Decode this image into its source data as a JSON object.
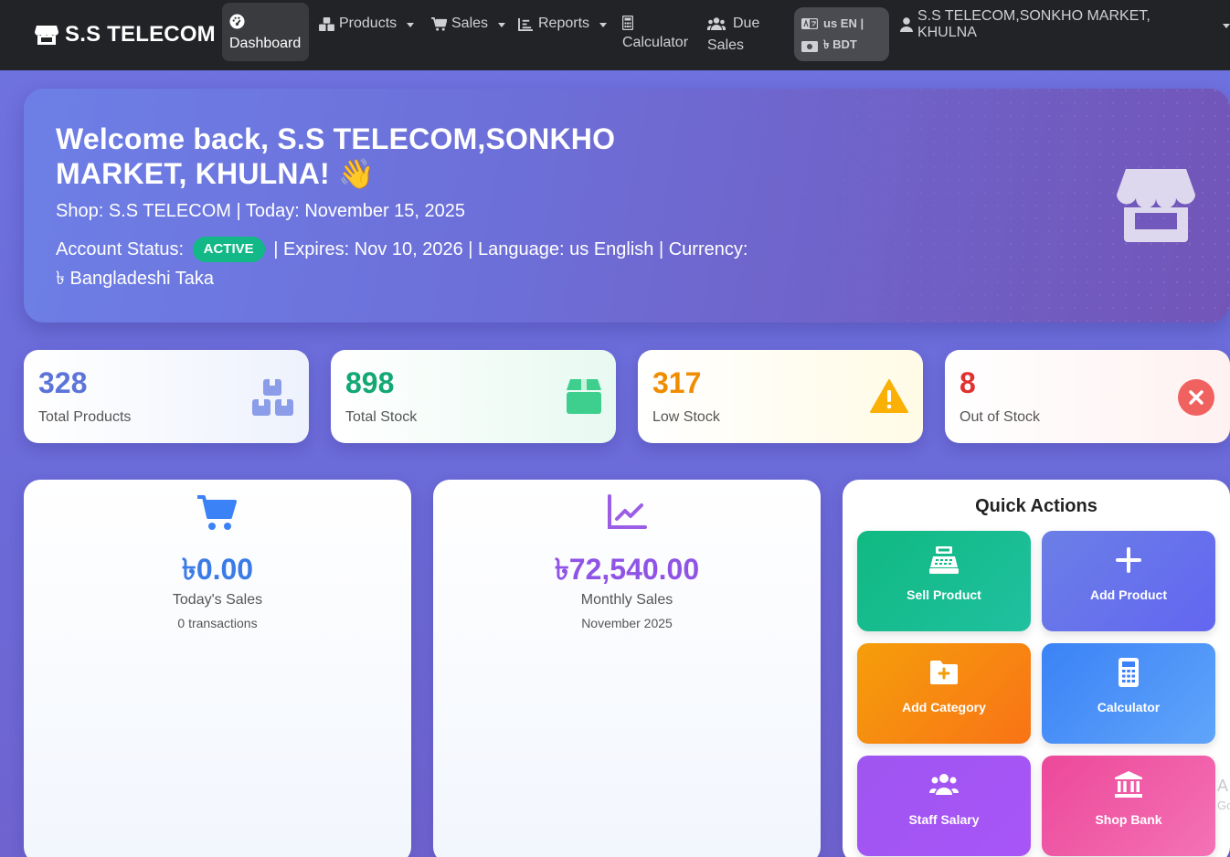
{
  "nav": {
    "brand": "S.S TELECOM",
    "dashboard": "Dashboard",
    "products": "Products",
    "sales": "Sales",
    "reports": "Reports",
    "calculator": "Calculator",
    "due_sales_line1": "Due",
    "due_sales_line2": "Sales",
    "lang_line1": "us EN |",
    "lang_line2": "৳ BDT",
    "user": "S.S TELECOM,SONKHO MARKET, KHULNA"
  },
  "hero": {
    "welcome": "Welcome back, S.S TELECOM,SONKHO MARKET, KHULNA! 👋",
    "shop_line": "Shop: S.S TELECOM | Today: November 15, 2025",
    "status_label": "Account Status:",
    "status_badge": "ACTIVE",
    "status_rest": "| Expires: Nov 10, 2026 | Language: us English | Currency: ৳ Bangladeshi Taka"
  },
  "stats": [
    {
      "value": "328",
      "label": "Total Products",
      "color": "#5b74d8"
    },
    {
      "value": "898",
      "label": "Total Stock",
      "color": "#12a874"
    },
    {
      "value": "317",
      "label": "Low Stock",
      "color": "#f08c00"
    },
    {
      "value": "8",
      "label": "Out of Stock",
      "color": "#e03131"
    }
  ],
  "today": {
    "amount": "৳0.00",
    "label": "Today's Sales",
    "sub": "0 transactions",
    "color": "#3b7be8"
  },
  "monthly": {
    "amount": "৳72,540.00",
    "label": "Monthly Sales",
    "sub": "November 2025",
    "color": "#8f54e6"
  },
  "quick": {
    "title": "Quick Actions",
    "sell": "Sell Product",
    "add_product": "Add Product",
    "add_category": "Add Category",
    "calculator": "Calculator",
    "staff_salary": "Staff Salary",
    "shop_bank": "Shop Bank"
  },
  "edge": {
    "a": "A",
    "b": "Go"
  }
}
